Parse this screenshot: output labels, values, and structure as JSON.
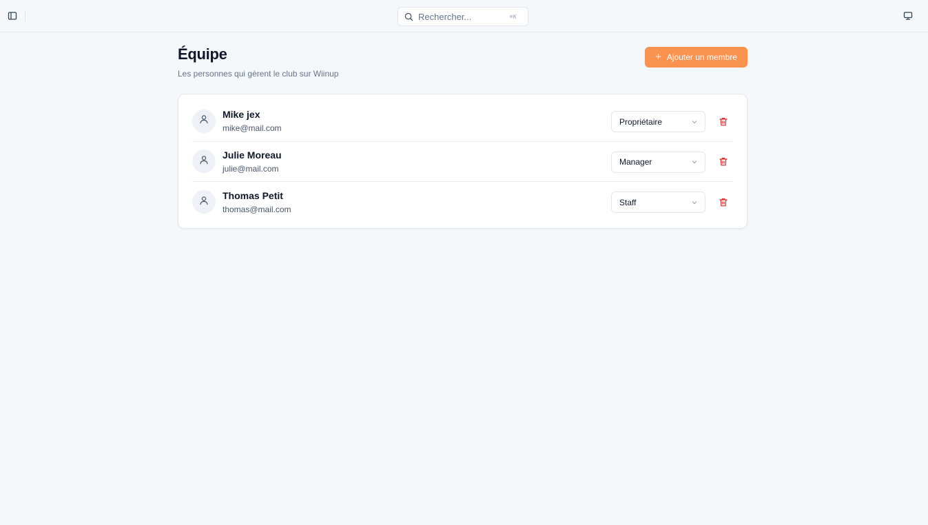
{
  "topbar": {
    "search": {
      "placeholder": "Rechercher...",
      "shortcut": "⌘K"
    },
    "icons": {
      "sidebar_toggle": "sidebar-panel-icon",
      "display": "monitor-icon",
      "search": "search-icon"
    }
  },
  "page": {
    "title": "Équipe",
    "subtitle": "Les personnes qui gèrent le club sur Wiinup",
    "add_button_label": "Ajouter un membre"
  },
  "members": [
    {
      "name": "Mike jex",
      "email": "mike@mail.com",
      "role": "Propriétaire"
    },
    {
      "name": "Julie Moreau",
      "email": "julie@mail.com",
      "role": "Manager"
    },
    {
      "name": "Thomas Petit",
      "email": "thomas@mail.com",
      "role": "Staff"
    }
  ],
  "colors": {
    "accent": "#fb9350",
    "danger": "#dc2626",
    "background": "#f5f8fb",
    "card": "#ffffff"
  }
}
